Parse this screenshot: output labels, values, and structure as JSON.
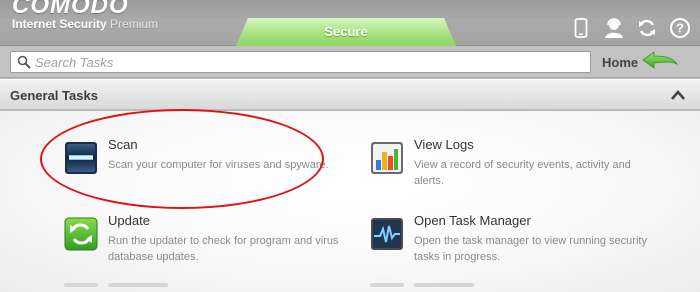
{
  "app": {
    "brand": "COMODO",
    "product_name": "Internet Security",
    "product_edition": "Premium",
    "status_tab": "Secure",
    "colors": {
      "accent_green": "#8ed462",
      "highlight_red": "#e01212"
    }
  },
  "toolbar_icons": [
    "widget-phone-icon",
    "support-icon",
    "refresh-icon",
    "help-icon"
  ],
  "search": {
    "placeholder": "Search Tasks",
    "value": ""
  },
  "home": {
    "label": "Home"
  },
  "section": {
    "title": "General Tasks"
  },
  "tasks": [
    {
      "name": "Scan",
      "description": "Scan your computer for viruses and spyware.",
      "icon": "scan-icon"
    },
    {
      "name": "View Logs",
      "description": "View a record of security events, activity and alerts.",
      "icon": "view-logs-icon"
    },
    {
      "name": "Update",
      "description": "Run the updater to check for program and virus database updates.",
      "icon": "update-icon"
    },
    {
      "name": "Open Task Manager",
      "description": "Open the task manager to view running security tasks in progress.",
      "icon": "task-manager-icon"
    }
  ]
}
